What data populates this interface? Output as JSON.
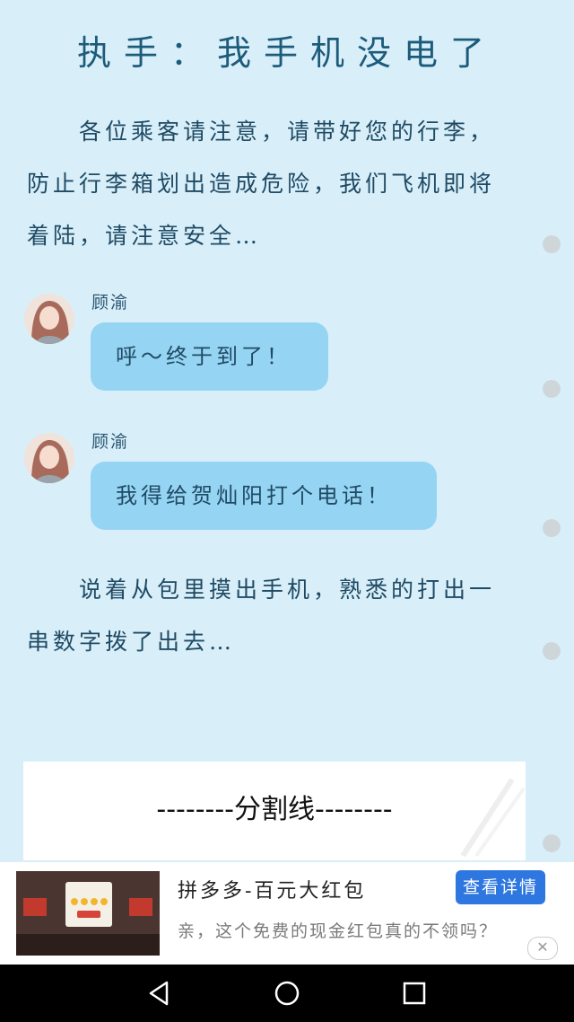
{
  "title": "执手：我手机没电了",
  "paragraphs": [
    "各位乘客请注意，请带好您的行李，防止行李箱划出造成危险，我们飞机即将着陆，请注意安全…",
    "说着从包里摸出手机，熟悉的打出一串数字拨了出去…"
  ],
  "messages": [
    {
      "speaker": "顾渝",
      "text": "呼～终于到了！"
    },
    {
      "speaker": "顾渝",
      "text": "我得给贺灿阳打个电话！"
    }
  ],
  "divider": {
    "text": "--------分割线--------"
  },
  "ad": {
    "title": "拼多多-百元大红包",
    "description": "亲，这个免费的现金红包真的不领吗？",
    "button": "查看详情",
    "close_icon": "close-icon"
  },
  "nav": {
    "back_icon": "back-triangle-icon",
    "home_icon": "home-circle-icon",
    "recents_icon": "recents-square-icon"
  },
  "colors": {
    "background": "#d8effa",
    "bubble": "#96d4f3",
    "ad_button": "#2f77e0"
  }
}
